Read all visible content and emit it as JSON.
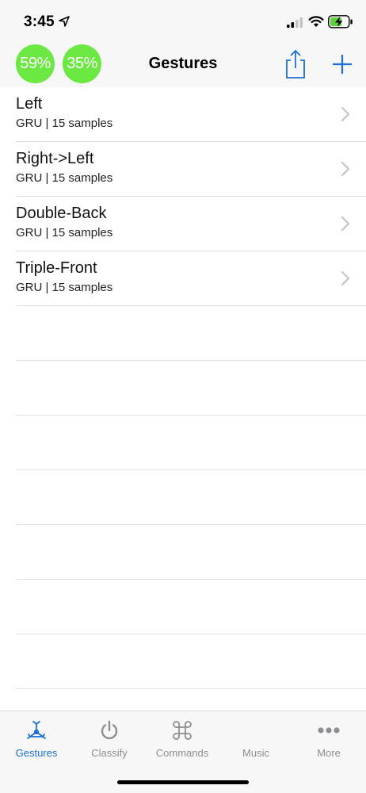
{
  "status_bar": {
    "time": "3:45"
  },
  "nav": {
    "title": "Gestures",
    "badges": [
      {
        "label": "59%",
        "value": 59
      },
      {
        "label": "35%",
        "value": 35
      }
    ],
    "badge_color": "#6ce843"
  },
  "gestures": [
    {
      "title": "Left",
      "subtitle": "GRU | 15 samples"
    },
    {
      "title": "Right->Left",
      "subtitle": "GRU | 15 samples"
    },
    {
      "title": "Double-Back",
      "subtitle": "GRU | 15 samples"
    },
    {
      "title": "Triple-Front",
      "subtitle": "GRU | 15 samples"
    }
  ],
  "tab_bar": {
    "accent_color": "#1c6fd8",
    "inactive_color": "#8e8e93",
    "tabs": [
      {
        "label": "Gestures",
        "icon": "gesture-icon",
        "active": true
      },
      {
        "label": "Classify",
        "icon": "power-icon",
        "active": false
      },
      {
        "label": "Commands",
        "icon": "command-icon",
        "active": false
      },
      {
        "label": "Music",
        "icon": "music-icon",
        "active": false
      },
      {
        "label": "More",
        "icon": "more-icon",
        "active": false
      }
    ]
  }
}
